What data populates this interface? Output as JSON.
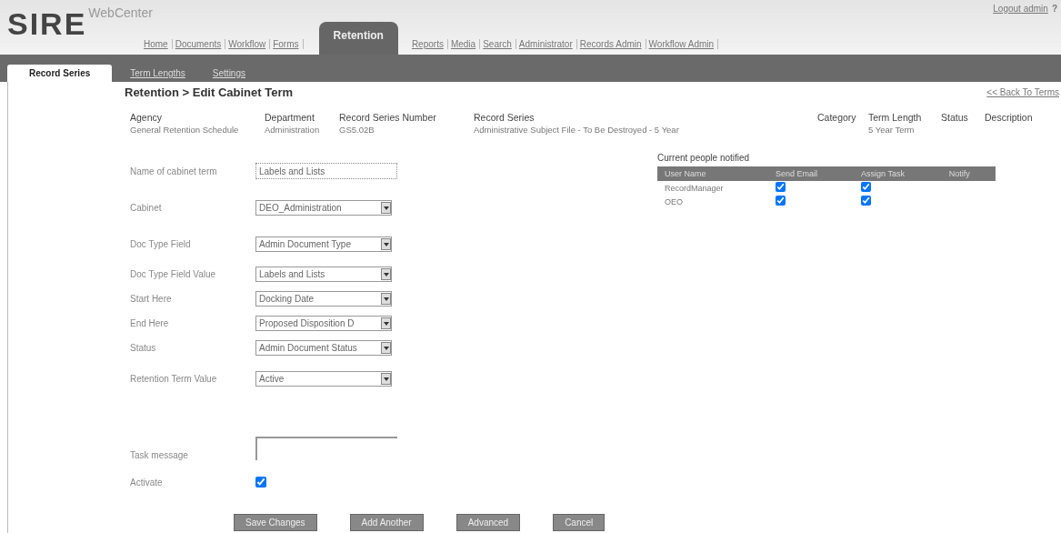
{
  "header": {
    "logo": "SIRE",
    "product": "WebCenter",
    "logout": "Logout admin",
    "help": "?"
  },
  "nav": [
    {
      "label": "Home",
      "selected": false
    },
    {
      "label": "Documents",
      "selected": false
    },
    {
      "label": "Workflow",
      "selected": false
    },
    {
      "label": "Forms",
      "selected": false
    },
    {
      "label": "Retention",
      "selected": true
    },
    {
      "label": "Reports",
      "selected": false
    },
    {
      "label": "Media",
      "selected": false
    },
    {
      "label": "Search",
      "selected": false
    },
    {
      "label": "Administrator",
      "selected": false
    },
    {
      "label": "Records Admin",
      "selected": false
    },
    {
      "label": "Workflow Admin",
      "selected": false
    }
  ],
  "subtabs": [
    {
      "label": "Record Series",
      "selected": true
    },
    {
      "label": "Term Lengths",
      "selected": false
    },
    {
      "label": "Settings",
      "selected": false
    }
  ],
  "breadcrumb": "Retention > Edit Cabinet Term",
  "back_link": "<< Back To Terms",
  "summary": [
    {
      "header": "Agency",
      "value": "General Retention Schedule"
    },
    {
      "header": "Department",
      "value": "Administration"
    },
    {
      "header": "Record Series Number",
      "value": "GS5.02B"
    },
    {
      "header": "Record Series",
      "value": "Administrative Subject File - To Be Destroyed - 5 Year"
    },
    {
      "header": "Category"
    },
    {
      "header": "Term Length",
      "value": "5 Year Term"
    },
    {
      "header": "Status"
    },
    {
      "header": "Description"
    }
  ],
  "form": [
    {
      "kind": "text",
      "label": "Name of cabinet term",
      "value": "Labels and Lists"
    },
    {
      "kind": "select",
      "label": "Cabinet",
      "value": "DEO_Administration"
    },
    {
      "kind": "select",
      "label": "Doc Type Field",
      "value": "Admin Document Type"
    },
    {
      "kind": "select",
      "label": "Doc Type Field Value",
      "value": "Labels and Lists"
    },
    {
      "kind": "select",
      "label": "Start Here",
      "value": "Docking Date"
    },
    {
      "kind": "select",
      "label": "End Here",
      "value": "Proposed Disposition D"
    },
    {
      "kind": "select",
      "label": "Status",
      "value": "Admin Document Status"
    },
    {
      "kind": "select",
      "label": "Retention Term Value",
      "value": "Active"
    },
    {
      "kind": "textarea",
      "label": "Task message"
    },
    {
      "kind": "checkbox",
      "label": "Activate",
      "checked": true
    }
  ],
  "notified": {
    "title": "Current people notified",
    "columns": [
      "User Name",
      "Send Email",
      "Assign Task",
      "Notify"
    ],
    "rows": [
      {
        "name": "RecordManager",
        "email": true,
        "task": true
      },
      {
        "name": "OEO",
        "email": true,
        "task": true
      }
    ]
  },
  "buttons": [
    "Save Changes",
    "Add Another",
    "Advanced",
    "Cancel"
  ]
}
